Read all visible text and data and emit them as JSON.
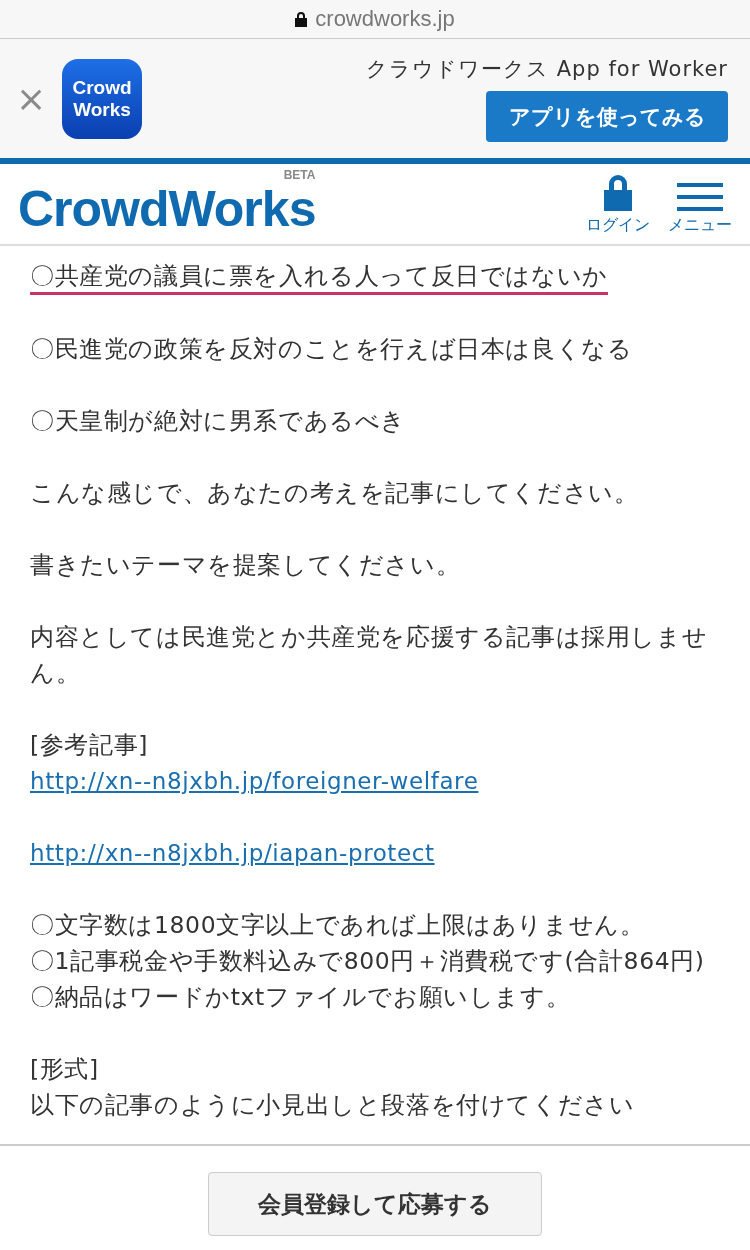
{
  "browser": {
    "url": "crowdworks.jp"
  },
  "app_banner": {
    "close": "×",
    "icon_lines": [
      "Crowd",
      "Works"
    ],
    "title": "クラウドワークス App for Worker",
    "button": "アプリを使ってみる"
  },
  "header": {
    "logo": "CrowdWorks",
    "badge": "BETA",
    "actions": [
      {
        "kind": "login",
        "label": "ログイン"
      },
      {
        "kind": "menu",
        "label": "メニュー"
      }
    ]
  },
  "content": {
    "paragraphs": [
      {
        "lines": [
          {
            "kind": "text",
            "text": "〇共産党の議員に票を入れる人って反日ではないか",
            "underlined": true
          }
        ]
      },
      {
        "lines": [
          {
            "kind": "text",
            "text": "〇民進党の政策を反対のことを行えば日本は良くなる",
            "underlined": false
          }
        ]
      },
      {
        "lines": [
          {
            "kind": "text",
            "text": "〇天皇制が絶対に男系であるべき",
            "underlined": false
          }
        ]
      },
      {
        "lines": [
          {
            "kind": "text",
            "text": "こんな感じで、あなたの考えを記事にしてください。",
            "underlined": false
          }
        ]
      },
      {
        "lines": [
          {
            "kind": "text",
            "text": "書きたいテーマを提案してください。",
            "underlined": false
          }
        ]
      },
      {
        "lines": [
          {
            "kind": "text",
            "text": "内容としては民進党とか共産党を応援する記事は採用しません。",
            "underlined": false
          }
        ]
      },
      {
        "lines": [
          {
            "kind": "text",
            "text": "[参考記事]",
            "underlined": false
          },
          {
            "kind": "link",
            "text": "http://xn--n8jxbh.jp/foreigner-welfare"
          }
        ]
      },
      {
        "lines": [
          {
            "kind": "link",
            "text": "http://xn--n8jxbh.jp/iapan-protect"
          }
        ]
      },
      {
        "lines": [
          {
            "kind": "text",
            "text": "〇文字数は1800文字以上であれば上限はありません。",
            "underlined": false
          },
          {
            "kind": "text",
            "text": "〇1記事税金や手数料込みで800円＋消費税です(合計864円)",
            "underlined": false
          },
          {
            "kind": "text",
            "text": "〇納品はワードかtxtファイルでお願いします。",
            "underlined": false
          }
        ]
      },
      {
        "lines": [
          {
            "kind": "text",
            "text": "[形式]",
            "underlined": false
          },
          {
            "kind": "text",
            "text": "以下の記事のように小見出しと段落を付けてください",
            "underlined": false
          }
        ]
      }
    ]
  },
  "apply_button": "会員登録して応募する"
}
